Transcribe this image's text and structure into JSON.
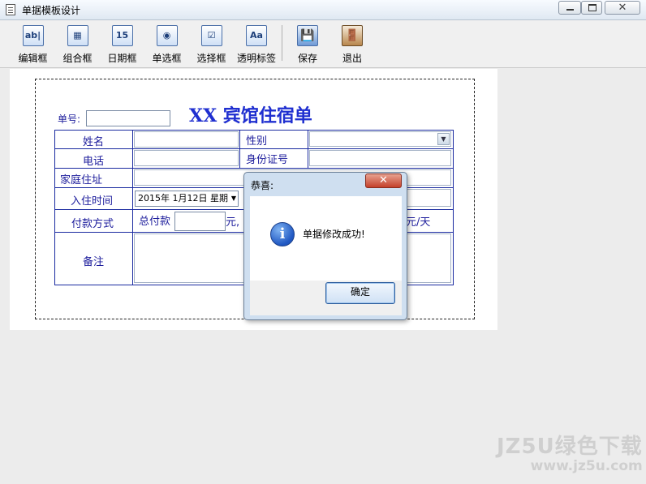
{
  "window": {
    "title": "单据模板设计",
    "close_glyph": "✕"
  },
  "toolbar": {
    "items": [
      {
        "label": "编辑框",
        "icon": "ab|"
      },
      {
        "label": "组合框",
        "icon": "▦"
      },
      {
        "label": "日期框",
        "icon": "15"
      },
      {
        "label": "单选框",
        "icon": "◉"
      },
      {
        "label": "选择框",
        "icon": "☑"
      },
      {
        "label": "透明标签",
        "icon": "Aa"
      },
      {
        "label": "保存",
        "icon": "💾"
      },
      {
        "label": "退出",
        "icon": "🚪"
      }
    ]
  },
  "form": {
    "heading": "XX 宾馆住宿单",
    "number_label": "单号:",
    "labels": {
      "name": "姓名",
      "gender": "性别",
      "phone": "电话",
      "id_card": "身份证号",
      "address": "家庭住址",
      "checkin_time": "入住时间",
      "payment": "付款方式",
      "total": "总付款",
      "yuan_sep": "元,",
      "per_day": "元/天",
      "remark": "备注"
    },
    "date_value": "2015年  1月12日  星期"
  },
  "dialog": {
    "title": "恭喜:",
    "message": "单据修改成功!",
    "ok_label": "确定",
    "close_glyph": "✕",
    "info_glyph": "i"
  },
  "watermark": {
    "line1": "JZ5U绿色下载",
    "line2": "www.jz5u.com"
  }
}
